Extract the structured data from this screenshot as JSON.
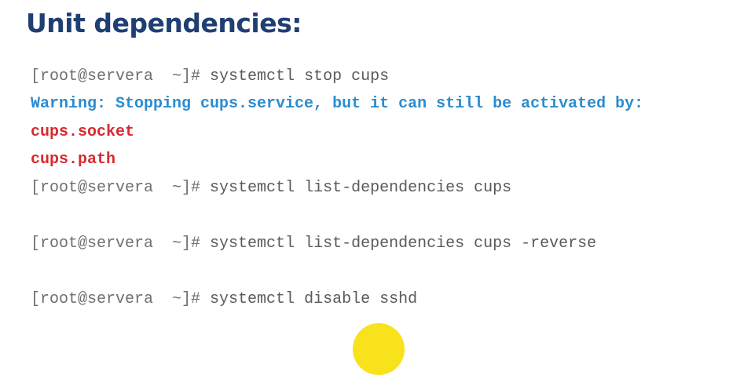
{
  "slide": {
    "title": "Unit dependencies:"
  },
  "terminal": {
    "prompt": "[root@servera  ~]# ",
    "lines": [
      {
        "command": "systemctl stop cups"
      },
      {
        "warning": "Warning: Stopping cups.service, but it can still be activated by:"
      },
      {
        "unit": "cups.socket"
      },
      {
        "unit": "cups.path"
      },
      {
        "command": "systemctl list-dependencies cups"
      },
      {
        "command": "systemctl list-dependencies cups -reverse"
      },
      {
        "command": "systemctl disable sshd"
      }
    ]
  },
  "colors": {
    "title": "#1f3f73",
    "warning": "#2b8ccf",
    "unit": "#d7292f",
    "prompt": "#6f6f6f",
    "cursor_highlight": "#f7e21c"
  }
}
